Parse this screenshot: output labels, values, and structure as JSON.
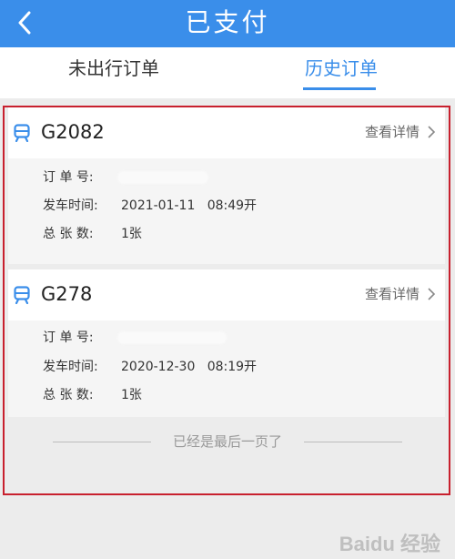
{
  "header": {
    "title": "已支付"
  },
  "tabs": [
    {
      "label": "未出行订单",
      "active": false
    },
    {
      "label": "历史订单",
      "active": true
    }
  ],
  "orders": [
    {
      "train_no": "G2082",
      "detail_label": "查看详情",
      "order_no_label": "订 单 号:",
      "departure_label": "发车时间:",
      "departure_value": "2021-01-11   08:49开",
      "tickets_label": "总 张 数:",
      "tickets_value": "1张"
    },
    {
      "train_no": "G278",
      "detail_label": "查看详情",
      "order_no_label": "订 单 号:",
      "departure_label": "发车时间:",
      "departure_value": "2020-12-30   08:19开",
      "tickets_label": "总 张 数:",
      "tickets_value": "1张"
    }
  ],
  "footer": {
    "end_text": "已经是最后一页了"
  },
  "watermark": "Baidu 经验",
  "colors": {
    "accent": "#3a8eea",
    "highlight_border": "#c8202e"
  },
  "icons": {
    "back": "chevron-left-icon",
    "train": "train-icon",
    "detail": "chevron-right-icon"
  }
}
